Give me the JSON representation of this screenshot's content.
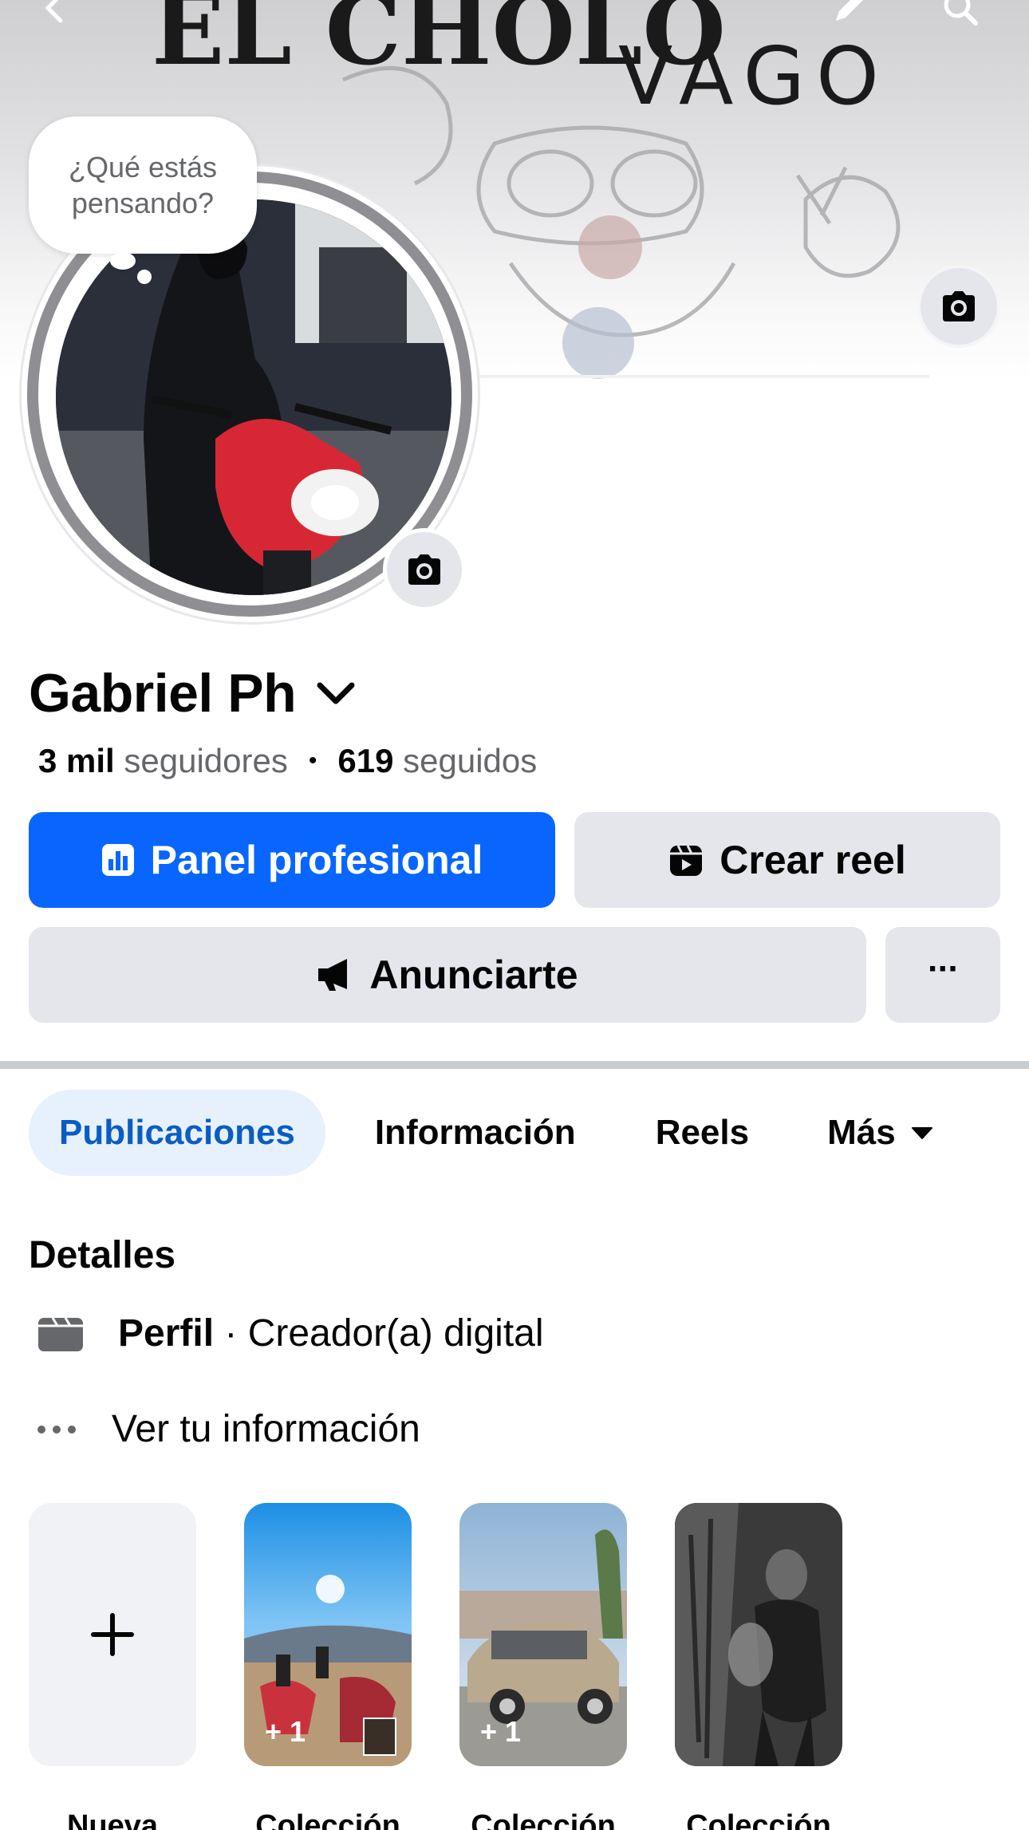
{
  "cover": {
    "title_left": "EL CHOLO",
    "title_right": "VAGO"
  },
  "header": {
    "back_icon": "chevron-left-icon",
    "edit_icon": "pencil-icon",
    "search_icon": "search-icon"
  },
  "thought_bubble": {
    "text": "¿Qué estás pensando?"
  },
  "profile": {
    "name": "Gabriel Ph",
    "followers_count": "3 mil",
    "followers_label": "seguidores",
    "separator": "•",
    "following_count": "619",
    "following_label": "seguidos"
  },
  "actions": {
    "panel_label": "Panel profesional",
    "reel_label": "Crear reel",
    "ads_label": "Anunciarte",
    "more_label": "···"
  },
  "tabs": [
    {
      "label": "Publicaciones",
      "active": true
    },
    {
      "label": "Información",
      "active": false
    },
    {
      "label": "Reels",
      "active": false
    },
    {
      "label": "Más",
      "active": false
    }
  ],
  "details": {
    "title": "Detalles",
    "profile_bold": "Perfil",
    "profile_rest": " · Creador(a) digital",
    "info_label": "Ver tu información"
  },
  "collections": [
    {
      "label": "Nueva",
      "count": ""
    },
    {
      "label": "Colección",
      "count": "+ 1"
    },
    {
      "label": "Colección",
      "count": "+ 1"
    },
    {
      "label": "Colección",
      "count": ""
    }
  ],
  "colors": {
    "primary": "#0866ff",
    "secondary_button": "#e4e6eb",
    "active_tab_bg": "#e7f0fd",
    "active_tab_text": "#0a5dc2"
  }
}
